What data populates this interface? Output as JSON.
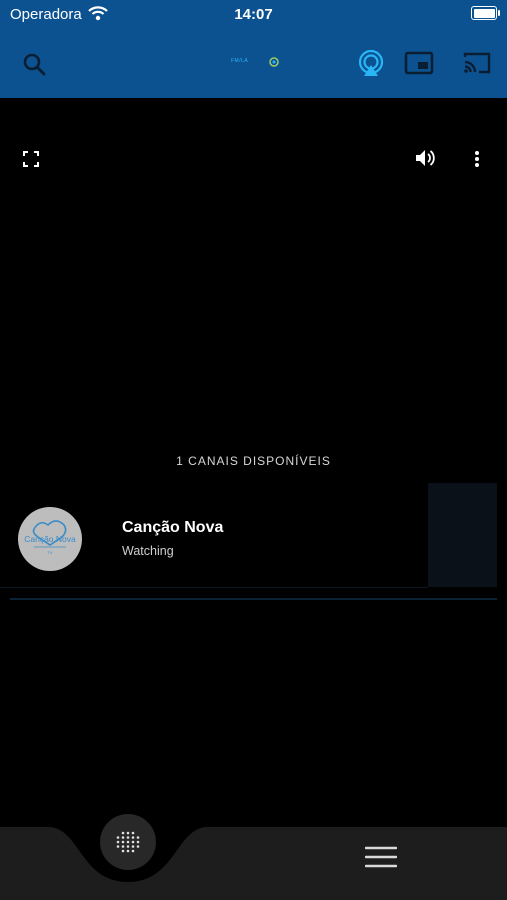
{
  "status_bar": {
    "carrier": "Operadora",
    "time": "14:07",
    "battery_level": 1.0
  },
  "toolbar": {
    "logo_text": "FM/LA",
    "icons": [
      "search-icon",
      "airplay-icon",
      "picture-in-picture-icon",
      "cast-icon"
    ]
  },
  "player": {
    "icons": [
      "fullscreen-icon",
      "volume-icon",
      "more-vertical-icon"
    ]
  },
  "channels": {
    "count_label": "1 CANAIS DISPONÍVEIS",
    "items": [
      {
        "name": "Canção Nova",
        "status": "Watching",
        "logo_text": "Canção Nova",
        "logo_sub": "TV"
      }
    ]
  },
  "bottom_nav": {
    "icons": [
      "grid-dots-icon",
      "menu-icon"
    ]
  },
  "colors": {
    "header_bg": "#0d5290",
    "accent": "#29b6f6",
    "bottom_bar": "#1d1d1d"
  }
}
